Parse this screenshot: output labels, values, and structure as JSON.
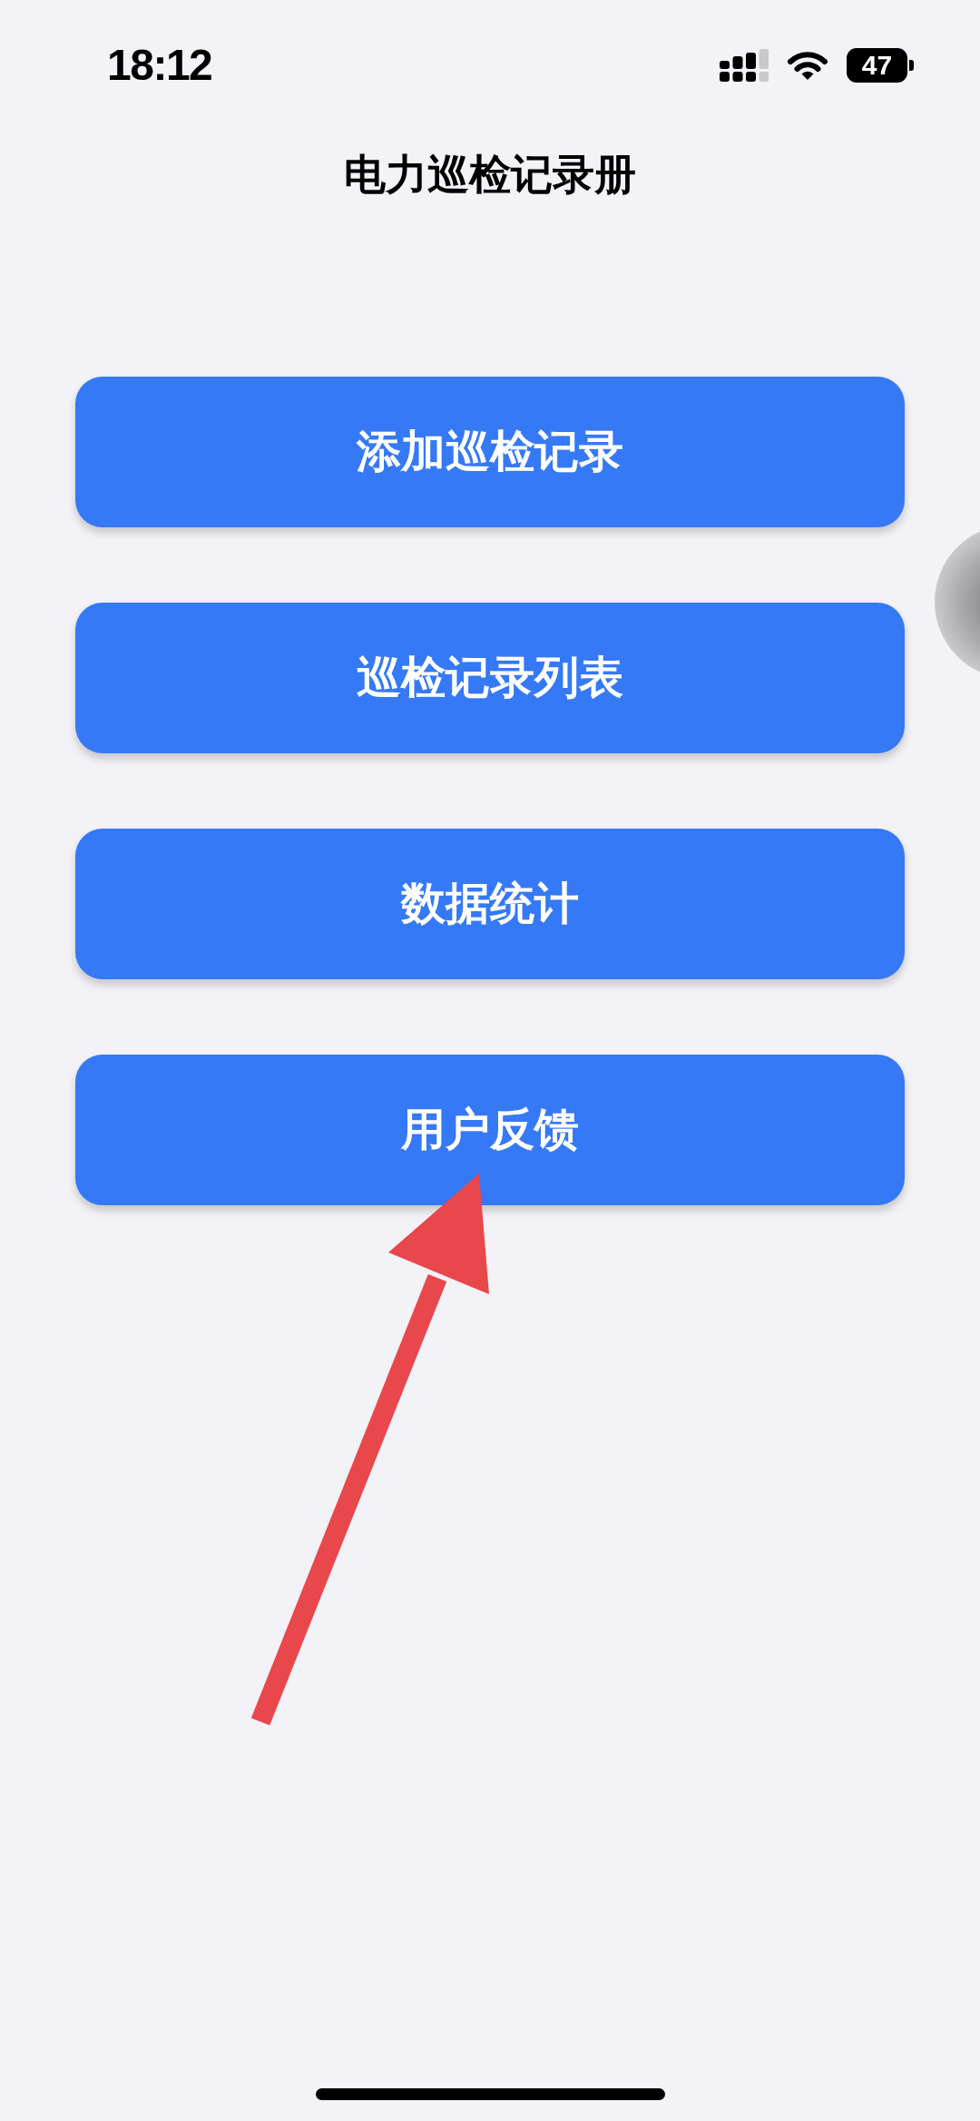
{
  "status_bar": {
    "time": "18:12",
    "battery": "47"
  },
  "title": "电力巡检记录册",
  "menu_buttons": [
    {
      "label": "添加巡检记录"
    },
    {
      "label": "巡检记录列表"
    },
    {
      "label": "数据统计"
    },
    {
      "label": "用户反馈"
    }
  ]
}
